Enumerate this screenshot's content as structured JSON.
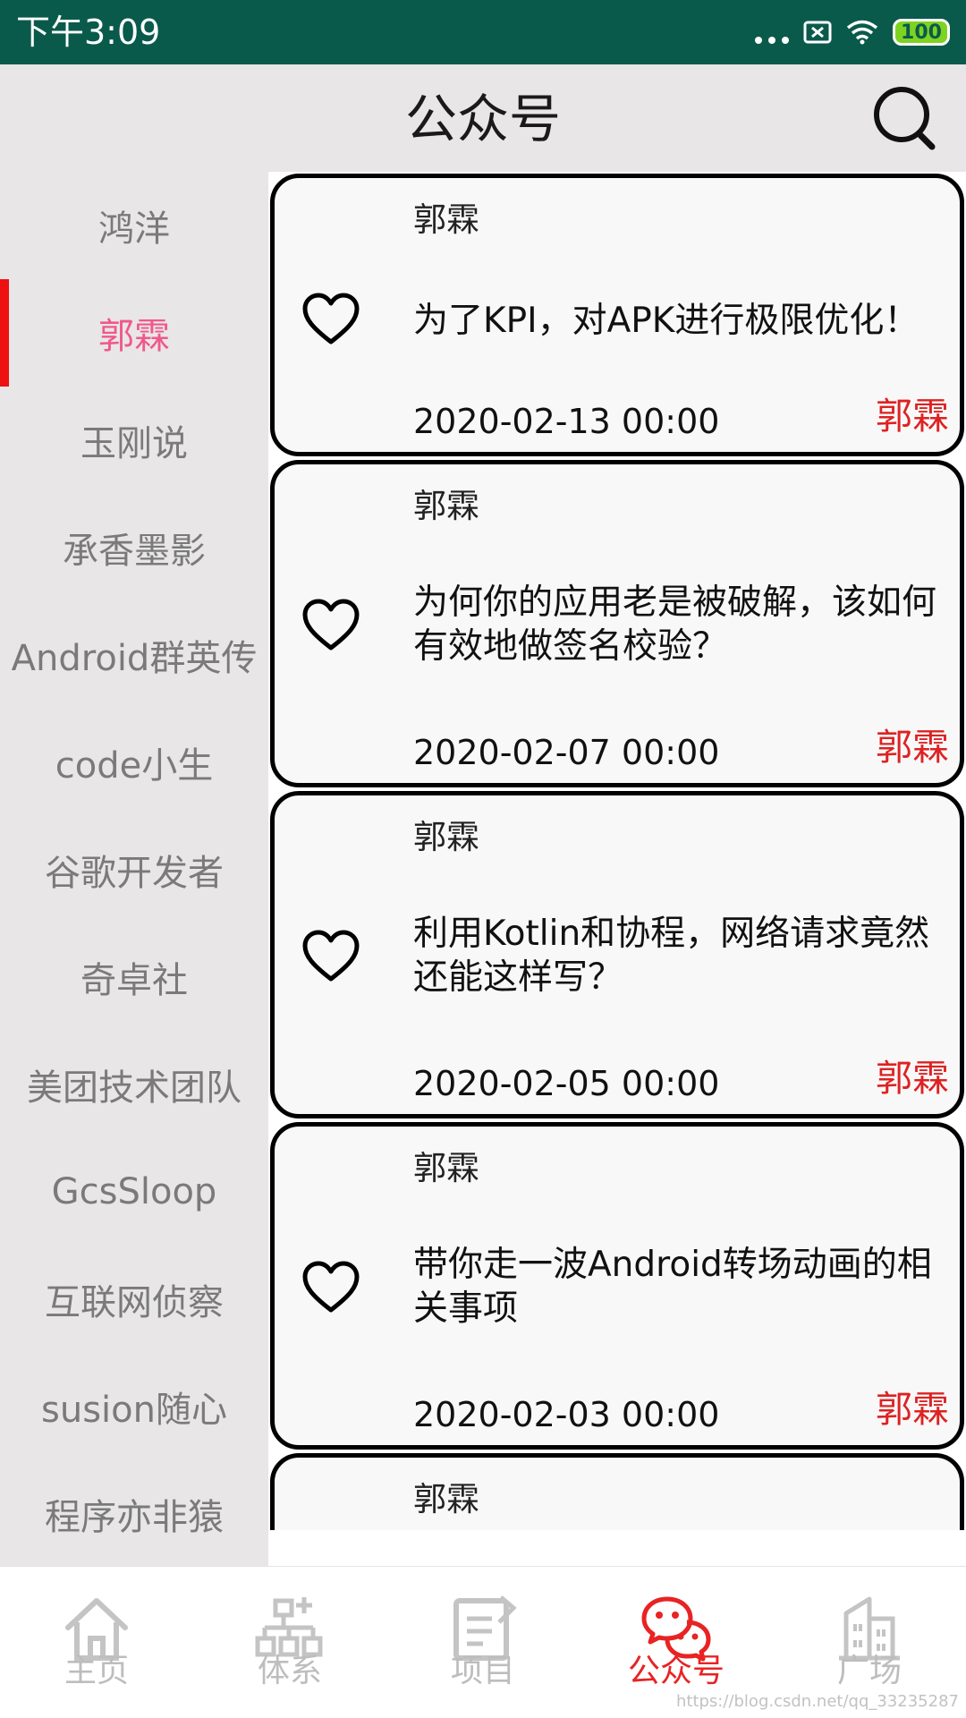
{
  "status_bar": {
    "time": "下午3:09",
    "battery": "100"
  },
  "header": {
    "title": "公众号"
  },
  "sidebar": {
    "items": [
      "鸿洋",
      "郭霖",
      "玉刚说",
      "承香墨影",
      "Android群英传",
      "code小生",
      "谷歌开发者",
      "奇卓社",
      "美团技术团队",
      "GcsSloop",
      "互联网侦察",
      "susion随心",
      "程序亦非猿"
    ],
    "active_index": 1
  },
  "articles": [
    {
      "author": "郭霖",
      "title": "为了KPI，对APK进行极限优化！",
      "date": "2020-02-13 00:00",
      "chapter": "郭霖"
    },
    {
      "author": "郭霖",
      "title": "为何你的应用老是被破解，该如何有效地做签名校验？",
      "date": "2020-02-07 00:00",
      "chapter": "郭霖"
    },
    {
      "author": "郭霖",
      "title": "利用Kotlin和协程，网络请求竟然还能这样写？",
      "date": "2020-02-05 00:00",
      "chapter": "郭霖"
    },
    {
      "author": "郭霖",
      "title": "带你走一波Android转场动画的相关事项",
      "date": "2020-02-03 00:00",
      "chapter": "郭霖"
    },
    {
      "author": "郭霖"
    }
  ],
  "bottom_nav": [
    {
      "label": "主页",
      "icon": "home-icon",
      "active": false
    },
    {
      "label": "体系",
      "icon": "system-icon",
      "active": false
    },
    {
      "label": "项目",
      "icon": "project-icon",
      "active": false
    },
    {
      "label": "公众号",
      "icon": "wechat-icon",
      "active": true
    },
    {
      "label": "广场",
      "icon": "square-icon",
      "active": false
    }
  ],
  "colors": {
    "status_bar": "#0a5a4c",
    "header_bg": "#e8e6e7",
    "active_sidebar": "#f0588c",
    "indicator": "#ee1111",
    "accent": "#e82323"
  },
  "watermark": "https://blog.csdn.net/qq_33235287"
}
